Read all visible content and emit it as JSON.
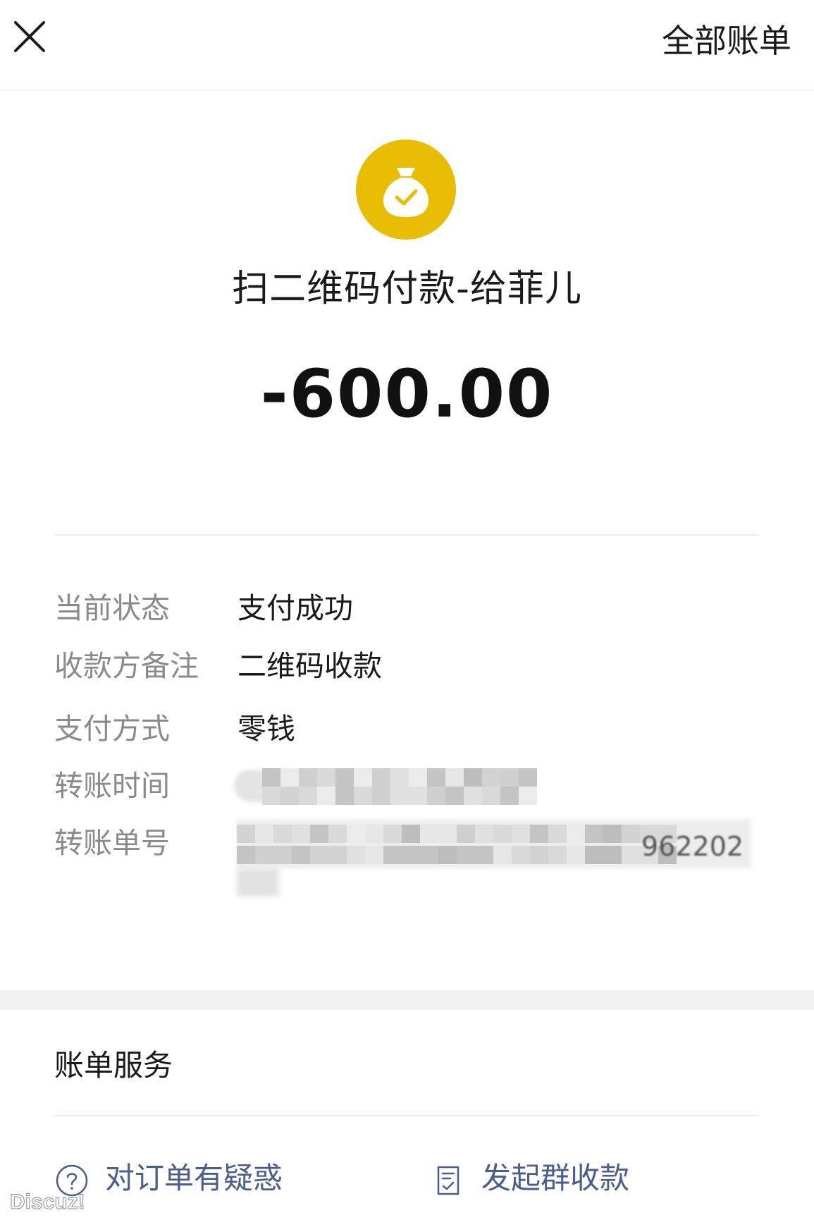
{
  "topbar": {
    "close_icon": "close-icon",
    "all_bills_label": "全部账单"
  },
  "header": {
    "icon": "money-bag-check-icon",
    "icon_color": "#e8bc00",
    "title": "扫二维码付款-给菲儿",
    "amount": "-600.00"
  },
  "details": {
    "status": {
      "label": "当前状态",
      "value": "支付成功"
    },
    "remark": {
      "label": "收款方备注",
      "value": "二维码收款"
    },
    "method": {
      "label": "支付方式",
      "value": "零钱"
    },
    "time": {
      "label": "转账时间"
    },
    "order": {
      "label": "转账单号",
      "visible_tail": "962202"
    }
  },
  "services": {
    "title": "账单服务",
    "items": [
      {
        "label": "对订单有疑惑",
        "icon": "question-circle-icon"
      },
      {
        "label": "发起群收款",
        "icon": "group-receipt-icon"
      }
    ],
    "link_color": "#4b5d8a"
  },
  "watermark": "Discuz!"
}
